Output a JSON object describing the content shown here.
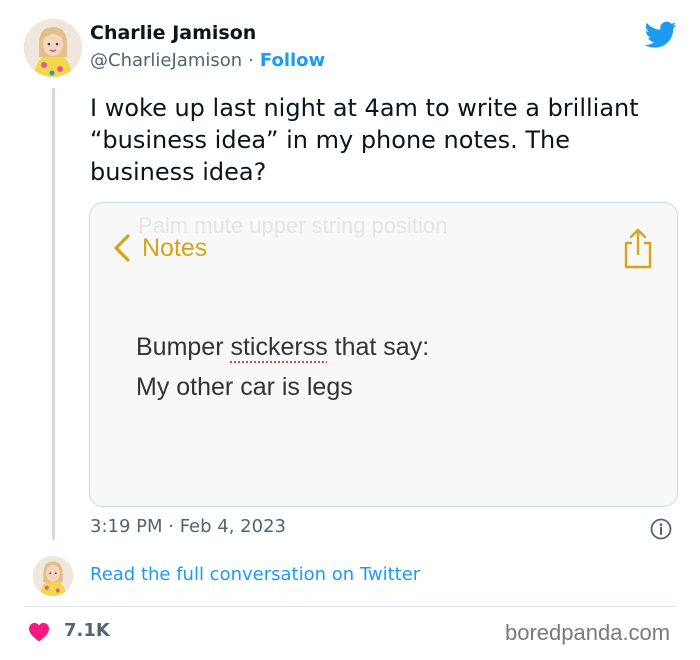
{
  "author": {
    "name": "Charlie Jamison",
    "handle": "@CharlieJamison",
    "separator": "·",
    "follow_label": "Follow"
  },
  "tweet": {
    "text": "I woke up last night at 4am to write a brilliant “business idea” in my phone notes. The business idea?",
    "timestamp": "3:19 PM · Feb 4, 2023"
  },
  "media": {
    "faded_text": "Palm mute upper string position",
    "back_label": "Notes",
    "line1_prefix": "Bumper ",
    "line1_typo": "stickerss",
    "line1_suffix": " that say:",
    "line2": "My other car is legs"
  },
  "conversation_link": "Read the full conversation on Twitter",
  "likes": "7.1K",
  "watermark": "boredpanda.com",
  "colors": {
    "twitter_blue": "#1d9bf0",
    "notes_accent": "#d8a31a",
    "heart": "#f91880"
  },
  "icons": [
    "twitter-bird-icon",
    "chevron-left-icon",
    "share-icon",
    "info-icon",
    "heart-icon"
  ]
}
